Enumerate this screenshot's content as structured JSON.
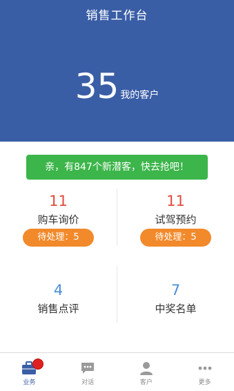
{
  "header": {
    "title": "销售工作台",
    "customer_count": "35",
    "customer_label": "我的客户",
    "background_color": "#3a5ea6"
  },
  "banner": {
    "text": "亲，有847个新潜客，快去抢吧！",
    "color": "#3cb54a"
  },
  "cards": [
    {
      "count": "11",
      "label": "购车询价",
      "pending": "待处理：5"
    },
    {
      "count": "11",
      "label": "试驾预约",
      "pending": "待处理：5"
    },
    {
      "count": "4",
      "label": "销售点评"
    },
    {
      "count": "7",
      "label": "中奖名单"
    }
  ],
  "colors": {
    "count_red": "#e04a3c",
    "count_blue": "#4a8ed8",
    "pending_orange": "#f28a2c"
  },
  "tabbar": {
    "items": [
      {
        "label": "业务",
        "icon": "briefcase-icon",
        "active": true
      },
      {
        "label": "对话",
        "icon": "chat-icon"
      },
      {
        "label": "客户",
        "icon": "person-icon"
      },
      {
        "label": "更多",
        "icon": "more-icon"
      }
    ]
  }
}
